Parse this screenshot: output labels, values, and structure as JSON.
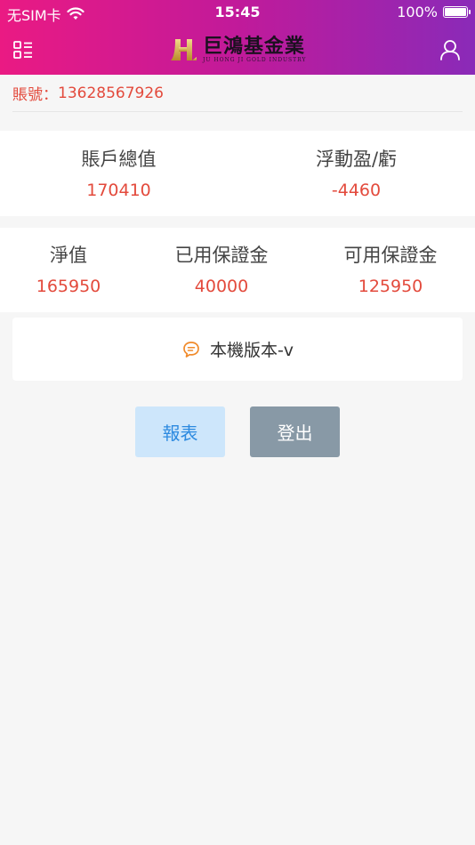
{
  "status_bar": {
    "carrier": "无SIM卡",
    "time": "15:45",
    "battery": "100%"
  },
  "header": {
    "logo_cn": "巨鴻基金業",
    "logo_en": "JU HONG JI GOLD INDUSTRY",
    "logo_mark": "H"
  },
  "account": {
    "label": "賬號：",
    "number": "13628567926"
  },
  "summary": {
    "total_label": "賬戶總值",
    "total_value": "170410",
    "pl_label": "浮動盈/虧",
    "pl_value": "-4460"
  },
  "margin": {
    "net_label": "淨值",
    "net_value": "165950",
    "used_label": "已用保證金",
    "used_value": "40000",
    "avail_label": "可用保證金",
    "avail_value": "125950"
  },
  "version": {
    "text": "本機版本-v"
  },
  "actions": {
    "report_label": "報表",
    "logout_label": "登出"
  },
  "colors": {
    "accent_red": "#e34a3c",
    "gradient_start": "#ea1a83",
    "gradient_end": "#8a2ab8",
    "report_bg": "#cde6fb",
    "logout_bg": "#8899a6"
  }
}
